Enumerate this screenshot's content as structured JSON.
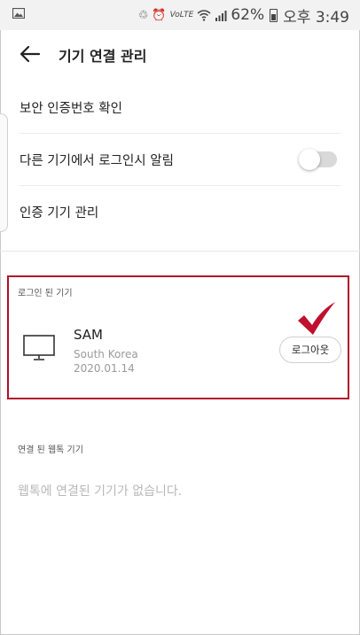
{
  "status_bar": {
    "small_label": "VoLTE",
    "battery": "62%",
    "time": "오후 3:49"
  },
  "header": {
    "title": "기기 연결 관리"
  },
  "settings": {
    "items": [
      {
        "label": "보안 인증번호 확인"
      },
      {
        "label": "다른 기기에서 로그인시 알림",
        "toggle": false
      },
      {
        "label": "인증 기기 관리"
      }
    ]
  },
  "logged_in": {
    "section_label": "로그인 된 기기",
    "device": {
      "name": "SAM",
      "location": "South Korea",
      "date": "2020.01.14",
      "icon": "monitor-icon"
    },
    "logout_label": "로그아웃"
  },
  "webtoc": {
    "section_label": "연결 된 웹톡 기기",
    "empty_text": "웹톡에 연결된 기기가 없습니다."
  },
  "colors": {
    "highlight": "#b0102a",
    "checkmark": "#c0102e"
  }
}
